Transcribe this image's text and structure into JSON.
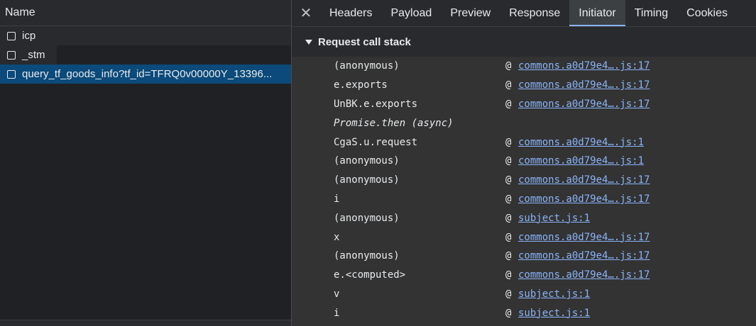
{
  "left": {
    "header": "Name",
    "requests": [
      {
        "name": "icp",
        "selected": false
      },
      {
        "name": "_stm",
        "selected": false
      },
      {
        "name": "query_tf_goods_info?tf_id=TFRQ0v00000Y_13396...",
        "selected": true
      }
    ]
  },
  "right": {
    "close_icon": "close-icon",
    "tabs": [
      "Headers",
      "Payload",
      "Preview",
      "Response",
      "Initiator",
      "Timing",
      "Cookies"
    ],
    "active_tab": "Initiator",
    "section_title": "Request call stack",
    "frames": [
      {
        "fn": "(anonymous)",
        "at": "@",
        "link": "commons.a0d79e4….js:17"
      },
      {
        "fn": "e.exports",
        "at": "@",
        "link": "commons.a0d79e4….js:17"
      },
      {
        "fn": "UnBK.e.exports",
        "at": "@",
        "link": "commons.a0d79e4….js:17"
      },
      {
        "fn": "Promise.then (async)",
        "at": "",
        "link": "",
        "async": true
      },
      {
        "fn": "CgaS.u.request",
        "at": "@",
        "link": "commons.a0d79e4….js:1"
      },
      {
        "fn": "(anonymous)",
        "at": "@",
        "link": "commons.a0d79e4….js:1"
      },
      {
        "fn": "(anonymous)",
        "at": "@",
        "link": "commons.a0d79e4….js:17"
      },
      {
        "fn": "i",
        "at": "@",
        "link": "commons.a0d79e4….js:17"
      },
      {
        "fn": "(anonymous)",
        "at": "@",
        "link": "subject.js:1"
      },
      {
        "fn": "x",
        "at": "@",
        "link": "commons.a0d79e4….js:17"
      },
      {
        "fn": "(anonymous)",
        "at": "@",
        "link": "commons.a0d79e4….js:17"
      },
      {
        "fn": "e.<computed>",
        "at": "@",
        "link": "commons.a0d79e4….js:17"
      },
      {
        "fn": "v",
        "at": "@",
        "link": "subject.js:1"
      },
      {
        "fn": "i",
        "at": "@",
        "link": "subject.js:1"
      }
    ]
  },
  "colors": {
    "selected_row": "#0b4a7a",
    "link": "#8ab4f8",
    "active_tab_underline": "#8ab4f8"
  }
}
